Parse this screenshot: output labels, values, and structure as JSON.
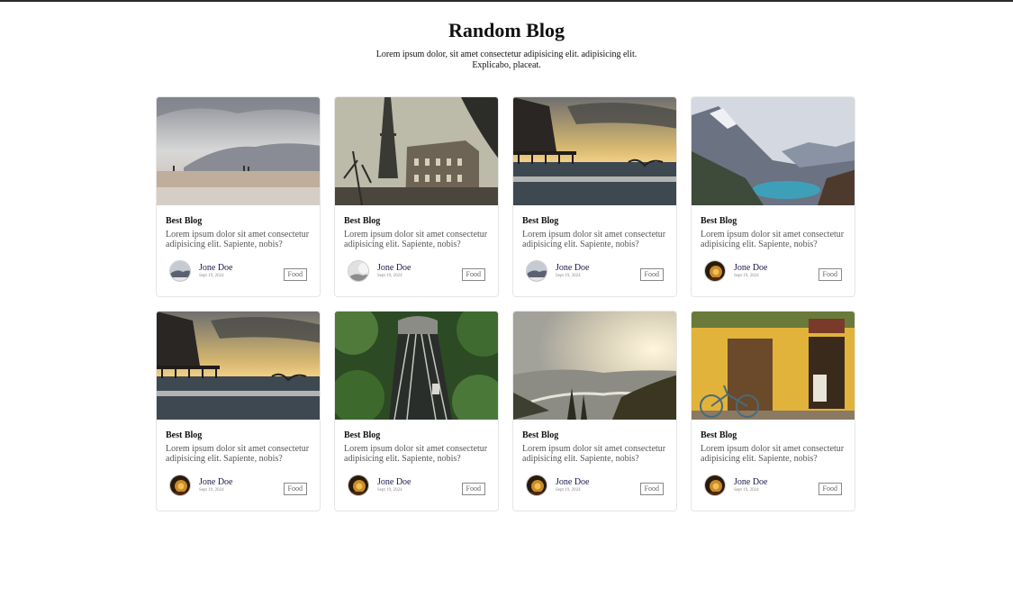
{
  "header": {
    "title": "Random Blog",
    "subtitle": "Lorem ipsum dolor, sit amet consectetur adipisicing elit. adipisicing elit. Explicabo, placeat."
  },
  "cards": [
    {
      "title": "Best Blog",
      "text": "Lorem ipsum dolor sit amet consectetur adipisicing elit. Sapiente, nobis?",
      "author": "Jone Doe",
      "date": "Sept 19, 2024",
      "tag": "Food",
      "image": "beach-mountains",
      "avatar": "mountain-avatar"
    },
    {
      "title": "Best Blog",
      "text": "Lorem ipsum dolor sit amet consectetur adipisicing elit. Sapiente, nobis?",
      "author": "Jone Doe",
      "date": "Sept 19, 2024",
      "tag": "Food",
      "image": "eiffel-tower",
      "avatar": "light-avatar"
    },
    {
      "title": "Best Blog",
      "text": "Lorem ipsum dolor sit amet consectetur adipisicing elit. Sapiente, nobis?",
      "author": "Jone Doe",
      "date": "Sept 19, 2024",
      "tag": "Food",
      "image": "pier-sunset",
      "avatar": "mountain-avatar"
    },
    {
      "title": "Best Blog",
      "text": "Lorem ipsum dolor sit amet consectetur adipisicing elit. Sapiente, nobis?",
      "author": "Jone Doe",
      "date": "Sept 19, 2024",
      "tag": "Food",
      "image": "mountain-lake",
      "avatar": "warm-avatar"
    },
    {
      "title": "Best Blog",
      "text": "Lorem ipsum dolor sit amet consectetur adipisicing elit. Sapiente, nobis?",
      "author": "Jone Doe",
      "date": "Sept 19, 2024",
      "tag": "Food",
      "image": "pier-sunset",
      "avatar": "warm-avatar"
    },
    {
      "title": "Best Blog",
      "text": "Lorem ipsum dolor sit amet consectetur adipisicing elit. Sapiente, nobis?",
      "author": "Jone Doe",
      "date": "Sept 19, 2024",
      "tag": "Food",
      "image": "forest-rails",
      "avatar": "warm-avatar"
    },
    {
      "title": "Best Blog",
      "text": "Lorem ipsum dolor sit amet consectetur adipisicing elit. Sapiente, nobis?",
      "author": "Jone Doe",
      "date": "Sept 19, 2024",
      "tag": "Food",
      "image": "valley-sunset",
      "avatar": "warm-avatar"
    },
    {
      "title": "Best Blog",
      "text": "Lorem ipsum dolor sit amet consectetur adipisicing elit. Sapiente, nobis?",
      "author": "Jone Doe",
      "date": "Sept 19, 2024",
      "tag": "Food",
      "image": "yellow-storefront",
      "avatar": "warm-avatar"
    }
  ]
}
